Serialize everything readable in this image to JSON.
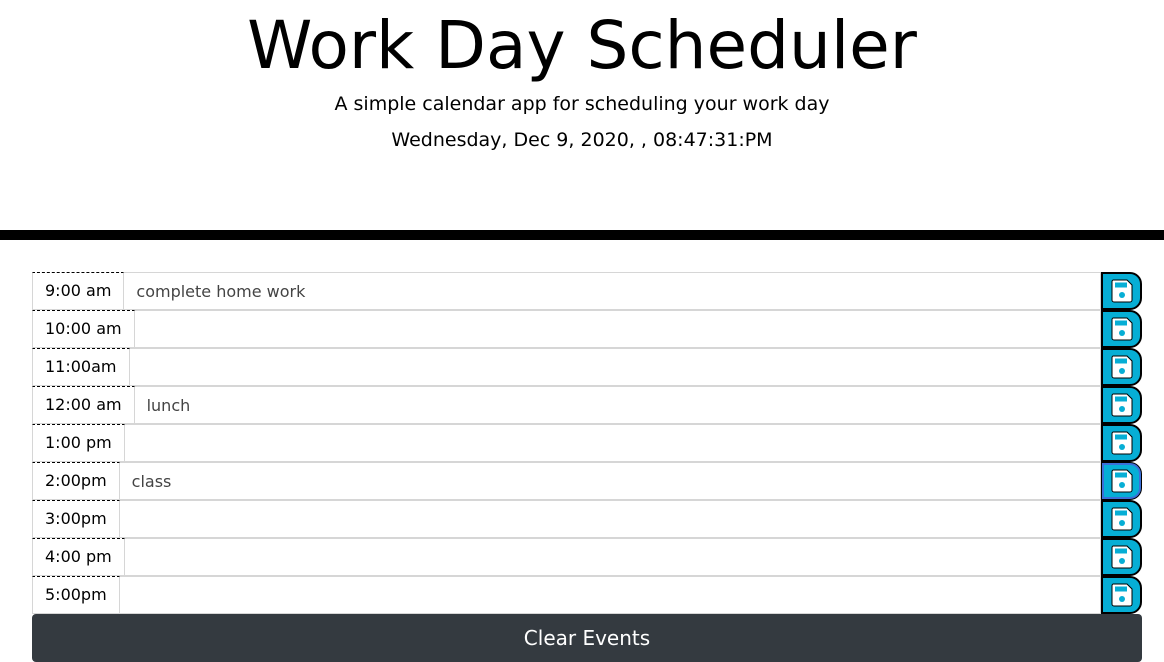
{
  "header": {
    "title": "Work Day Scheduler",
    "subtitle": "A simple calendar app for scheduling your work day",
    "datetime": "Wednesday, Dec 9, 2020, , 08:47:31:PM"
  },
  "schedule": {
    "rows": [
      {
        "hour": "9:00 am",
        "event": "complete home work"
      },
      {
        "hour": "10:00 am",
        "event": ""
      },
      {
        "hour": "11:00am",
        "event": ""
      },
      {
        "hour": "12:00 am",
        "event": "lunch"
      },
      {
        "hour": "1:00 pm",
        "event": ""
      },
      {
        "hour": "2:00pm",
        "event": "class"
      },
      {
        "hour": "3:00pm",
        "event": ""
      },
      {
        "hour": "4:00 pm",
        "event": ""
      },
      {
        "hour": "5:00pm",
        "event": ""
      }
    ],
    "save_icon": "floppy-disk-icon"
  },
  "actions": {
    "clear_label": "Clear Events"
  },
  "colors": {
    "save_button": "#06aed5",
    "clear_button": "#343a40",
    "divider": "#000000"
  }
}
